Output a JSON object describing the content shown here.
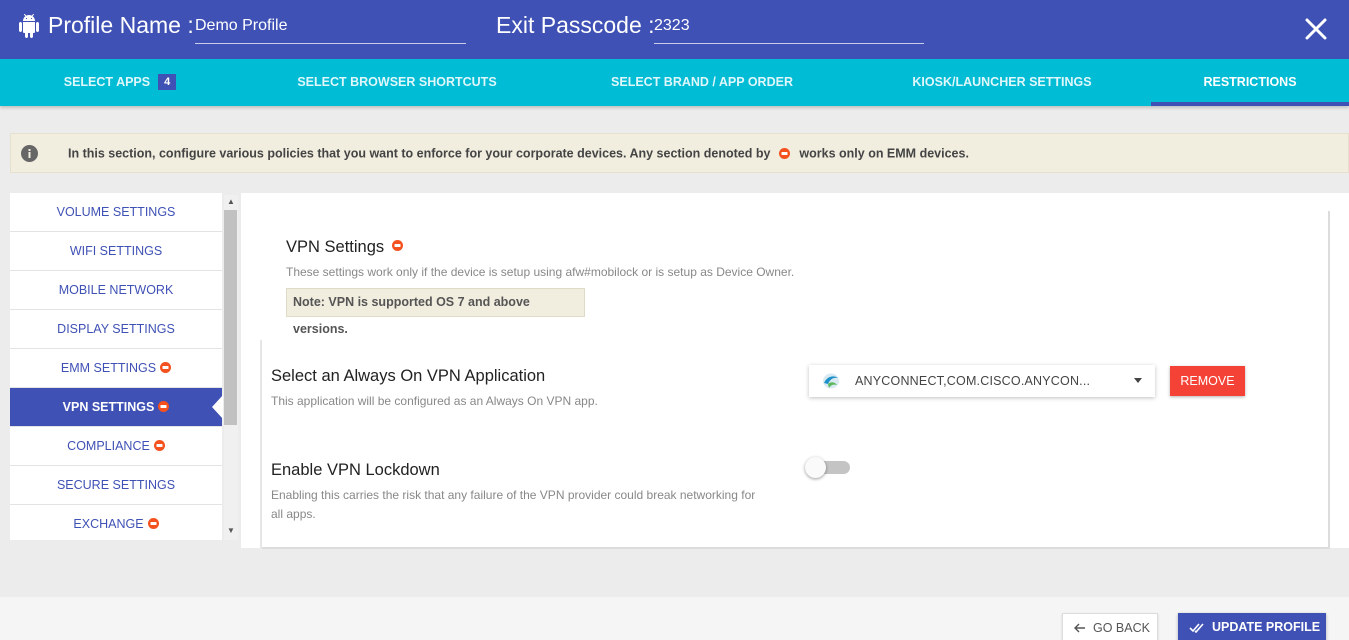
{
  "header": {
    "profile_label": "Profile Name :",
    "profile_value": "Demo Profile",
    "passcode_label": "Exit Passcode :",
    "passcode_value": "2323",
    "android_icon": "android-icon",
    "close_icon": "close-icon"
  },
  "tabs": [
    {
      "label": "SELECT APPS",
      "badge": "4"
    },
    {
      "label": "SELECT BROWSER SHORTCUTS"
    },
    {
      "label": "SELECT BRAND / APP ORDER"
    },
    {
      "label": "KIOSK/LAUNCHER SETTINGS"
    },
    {
      "label": "RESTRICTIONS",
      "active": true
    }
  ],
  "info": {
    "text_before": "In this section, configure various policies that you want to enforce for your corporate devices. Any section denoted by",
    "text_after": "works only on EMM devices.",
    "icon": "info-icon"
  },
  "side_menu": [
    {
      "label": "VOLUME SETTINGS"
    },
    {
      "label": "WIFI SETTINGS"
    },
    {
      "label": "MOBILE NETWORK"
    },
    {
      "label": "DISPLAY SETTINGS"
    },
    {
      "label": "EMM SETTINGS",
      "emm": true
    },
    {
      "label": "VPN SETTINGS",
      "emm": true,
      "active": true
    },
    {
      "label": "COMPLIANCE",
      "emm": true
    },
    {
      "label": "SECURE SETTINGS"
    },
    {
      "label": "EXCHANGE",
      "emm": true
    }
  ],
  "vpn": {
    "title": "VPN Settings",
    "subtitle": "These settings work only if the device is setup using afw#mobilock or is setup as Device Owner.",
    "note": "Note: VPN is supported OS 7 and above versions.",
    "always_on": {
      "title": "Select an Always On VPN Application",
      "description": "This application will be configured as an Always On VPN app.",
      "selected_app": "ANYCONNECT,COM.CISCO.ANYCON...",
      "remove_label": "REMOVE"
    },
    "lockdown": {
      "title": "Enable VPN Lockdown",
      "description_line1": "Enabling this carries the risk that any failure of the VPN provider could break networking for",
      "description_line2": "all apps.",
      "enabled": false
    }
  },
  "footer": {
    "go_back_label": "GO BACK",
    "update_label": "UPDATE PROFILE"
  },
  "colors": {
    "primary": "#3f51b5",
    "tab_bar": "#00bcd4",
    "danger": "#f44336",
    "emm_badge": "#f4511e"
  }
}
